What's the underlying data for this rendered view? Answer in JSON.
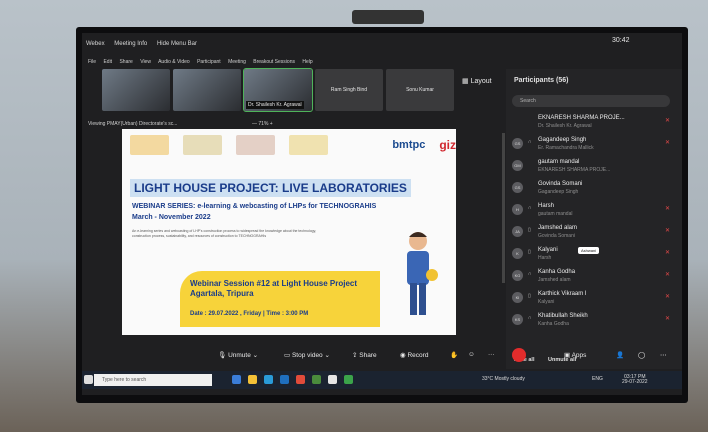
{
  "window": {
    "title": "Webex",
    "meeting_info": "Meeting Info",
    "hide_menu": "Hide Menu Bar",
    "clock": "30:42"
  },
  "menu": [
    "File",
    "Edit",
    "Share",
    "View",
    "Audio & Video",
    "Participant",
    "Meeting",
    "Breakout Sessions",
    "Help"
  ],
  "thumbnails": [
    {
      "name": "",
      "caption": "",
      "video": true
    },
    {
      "name": "",
      "caption": "",
      "video": true
    },
    {
      "name": "",
      "caption": "Dr. Shailesh Kr. Agrawal",
      "video": true,
      "speaker": true
    },
    {
      "name": "Ram Singh Bind",
      "caption": "",
      "video": false
    },
    {
      "name": "Sonu Kumar",
      "caption": "",
      "video": false
    }
  ],
  "layout_label": "Layout",
  "viewing": "Viewing PMAY(Urban) Directorate's sc...",
  "zoom": "71%",
  "slide": {
    "brand1": "bmtpc",
    "brand2": "giz",
    "title": "LIGHT HOUSE PROJECT: LIVE LABORATORIES",
    "series": "WEBINAR SERIES: e-learning & webcasting of LHPs for TECHNOGRAHIS",
    "period": "March - November 2022",
    "description": "An e-learning series and webcasting of LHP's construction process to widespread the knowledge about the technology, construction process, sustainability, and resources of construction to TECHNOGRAHIs",
    "session": "Webinar Session #12 at Light House Project Agartala, Tripura",
    "datetime": "Date : 29.07.2022 , Friday  |  Time : 3:00 PM"
  },
  "participants": {
    "header": "Participants (56)",
    "search_placeholder": "Search",
    "list": [
      {
        "initials": "",
        "name": "EKNARESH SHARMA PROJE...",
        "sub": "Dr. Shailesh Kr. Agrawal",
        "muted": true
      },
      {
        "initials": "GS",
        "name": "Gagandeep Singh",
        "sub": "Er. Ramachandra Mallick",
        "muted": true
      },
      {
        "initials": "GM",
        "name": "gautam mandal",
        "sub": "EKNARESH SHARMA PROJE...",
        "muted": false
      },
      {
        "initials": "GS",
        "name": "Govinda Somani",
        "sub": "Gagandeep Singh",
        "muted": false
      },
      {
        "initials": "H",
        "name": "Harsh",
        "sub": "gautam mandal",
        "muted": true
      },
      {
        "initials": "JA",
        "name": "Jamshed alam",
        "sub": "Govinda Somani",
        "muted": true
      },
      {
        "initials": "K",
        "name": "Kalyani",
        "sub": "Harsh",
        "muted": true,
        "tooltip": "Ashwani"
      },
      {
        "initials": "KG",
        "name": "Kanha Godha",
        "sub": "Jamshed alam",
        "muted": true
      },
      {
        "initials": "KI",
        "name": "Karthick Vikraam I",
        "sub": "Kalyani",
        "muted": true
      },
      {
        "initials": "KS",
        "name": "Khatibullah Sheikh",
        "sub": "Kanha Godha",
        "muted": true
      }
    ],
    "mute_all": "Mute all",
    "unmute_all": "Unmute all"
  },
  "toolbar": {
    "unmute": "Unmute",
    "stop_video": "Stop video",
    "share": "Share",
    "record": "Record",
    "apps": "Apps"
  },
  "taskbar": {
    "search_placeholder": "Type here to search",
    "weather": "33°C  Mostly cloudy",
    "lang": "ENG",
    "time": "03:17 PM",
    "date": "29-07-2022"
  },
  "colors": {
    "mute_red": "#e24848",
    "end_red": "#e22c2c",
    "slide_blue": "#1a3c8a",
    "slide_yellow": "#f7d33a"
  }
}
